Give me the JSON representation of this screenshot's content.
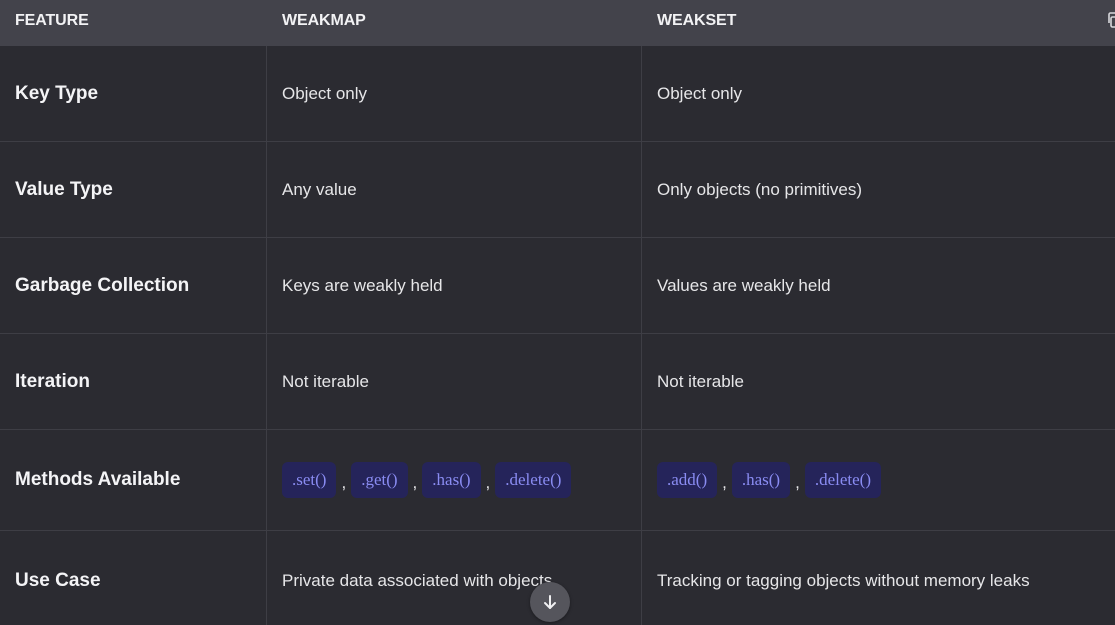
{
  "header": {
    "feature": "FEATURE",
    "weakmap": "WEAKMAP",
    "weakset": "WEAKSET",
    "action_icon": "copy-icon"
  },
  "rows": [
    {
      "feature": "Key Type",
      "weakmap": "Object only",
      "weakset": "Object only"
    },
    {
      "feature": "Value Type",
      "weakmap": "Any value",
      "weakset": "Only objects (no primitives)"
    },
    {
      "feature": "Garbage Collection",
      "weakmap": "Keys are weakly held",
      "weakset": "Values are weakly held"
    },
    {
      "feature": "Iteration",
      "weakmap": "Not iterable",
      "weakset": "Not iterable"
    },
    {
      "feature": "Methods Available",
      "weakmap_methods": [
        ".set()",
        ".get()",
        ".has()",
        ".delete()"
      ],
      "weakset_methods": [
        ".add()",
        ".has()",
        ".delete()"
      ],
      "separator": ","
    },
    {
      "feature": "Use Case",
      "weakmap": "Private data associated with objects",
      "weakset": "Tracking or tagging objects without memory leaks"
    }
  ],
  "scroll_button": {
    "icon": "arrow-down-icon"
  },
  "colors": {
    "background": "#2b2b31",
    "header_background": "#43434b",
    "code_background": "#25245a",
    "code_text": "#8a8cf2"
  }
}
